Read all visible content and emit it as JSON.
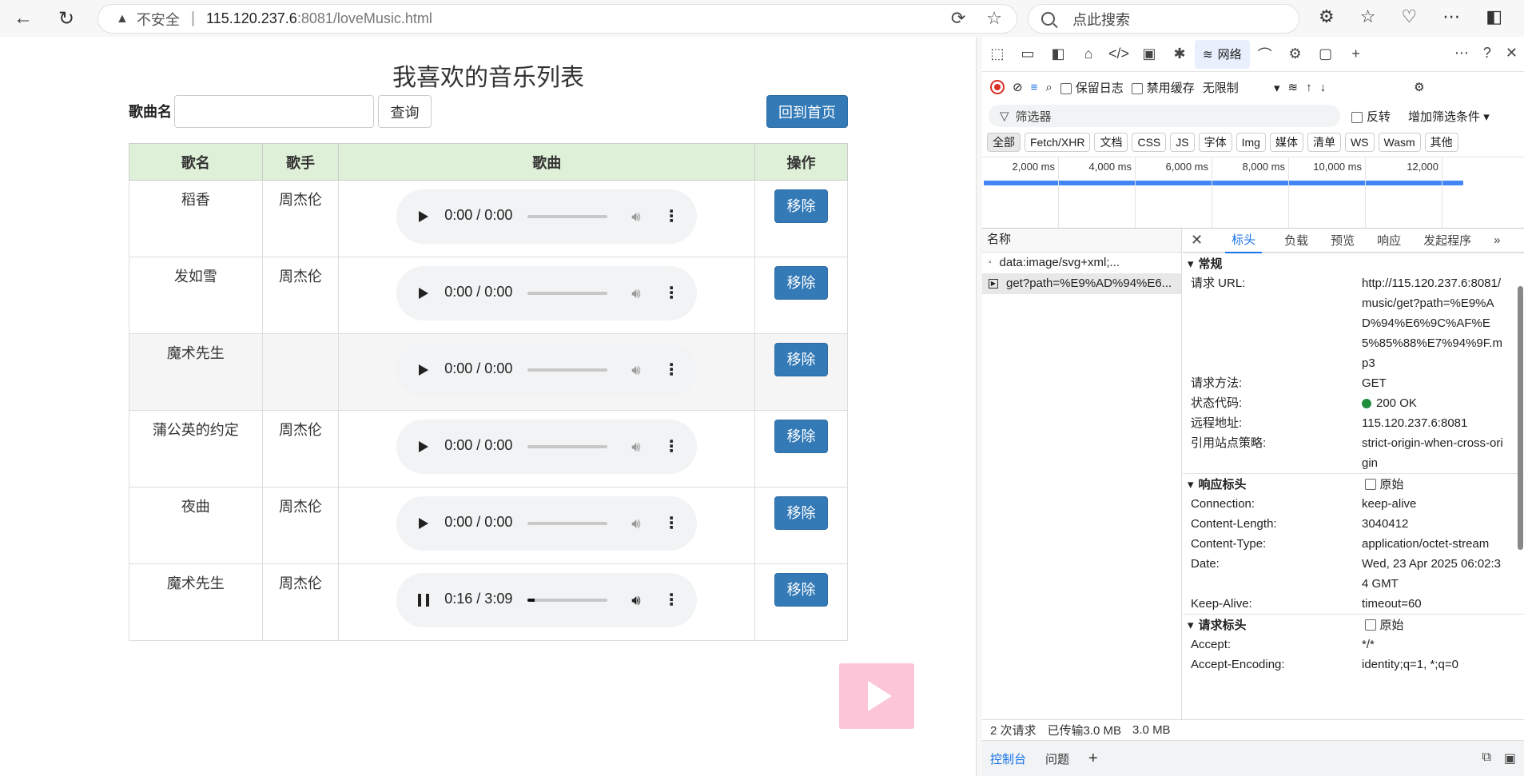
{
  "browser": {
    "insecure_label": "不安全",
    "url_host": "115.120.237.6",
    "url_port": ":8081",
    "url_path": "/loveMusic.html",
    "search_placeholder": "点此搜索"
  },
  "page": {
    "title": "我喜欢的音乐列表",
    "search_label": "歌曲名",
    "search_value": "",
    "query_button": "查询",
    "home_button": "回到首页",
    "columns": [
      "歌名",
      "歌手",
      "歌曲",
      "操作"
    ],
    "remove_label": "移除",
    "rows": [
      {
        "name": "稻香",
        "singer": "周杰伦",
        "time": "0:00 / 0:00",
        "progress": 0
      },
      {
        "name": "发如雪",
        "singer": "周杰伦",
        "time": "0:00 / 0:00",
        "progress": 0
      },
      {
        "name": "魔术先生",
        "singer": "",
        "time": "0:00 / 0:00",
        "progress": 0
      },
      {
        "name": "蒲公英的约定",
        "singer": "周杰伦",
        "time": "0:00 / 0:00",
        "progress": 0
      },
      {
        "name": "夜曲",
        "singer": "周杰伦",
        "time": "0:00 / 0:00",
        "progress": 0
      },
      {
        "name": "魔术先生",
        "singer": "周杰伦",
        "time": "0:16 / 3:09",
        "progress": 0.085,
        "playing": true
      }
    ]
  },
  "devtools": {
    "network_tab": "网络",
    "preserve_log": "保留日志",
    "disable_cache": "禁用缓存",
    "throttle": "无限制",
    "filter_placeholder": "筛选器",
    "invert": "反转",
    "more_filters": "增加筛选条件",
    "types": [
      "全部",
      "Fetch/XHR",
      "文档",
      "CSS",
      "JS",
      "字体",
      "Img",
      "媒体",
      "清单",
      "WS",
      "Wasm",
      "其他"
    ],
    "ticks": [
      "2,000 ms",
      "4,000 ms",
      "6,000 ms",
      "8,000 ms",
      "10,000 ms",
      "12,000"
    ],
    "name_header": "名称",
    "requests": [
      "data:image/svg+xml;...",
      "get?path=%E9%AD%94%E6..."
    ],
    "detail_tabs": [
      "标头",
      "负载",
      "预览",
      "响应",
      "发起程序"
    ],
    "general_title": "常规",
    "general": [
      {
        "k": "请求 URL:",
        "v": "http://115.120.237.6:8081/music/get?path=%E9%AD%94%E6%9C%AF%E5%85%88%E7%94%9F.mp3"
      },
      {
        "k": "请求方法:",
        "v": "GET"
      },
      {
        "k": "状态代码:",
        "v": "200 OK"
      },
      {
        "k": "远程地址:",
        "v": "115.120.237.6:8081"
      },
      {
        "k": "引用站点策略:",
        "v": "strict-origin-when-cross-origin"
      }
    ],
    "response_title": "响应标头",
    "raw_label": "原始",
    "response": [
      {
        "k": "Connection:",
        "v": "keep-alive"
      },
      {
        "k": "Content-Length:",
        "v": "3040412"
      },
      {
        "k": "Content-Type:",
        "v": "application/octet-stream"
      },
      {
        "k": "Date:",
        "v": "Wed, 23 Apr 2025 06:02:34 GMT"
      },
      {
        "k": "Keep-Alive:",
        "v": "timeout=60"
      }
    ],
    "request_title": "请求标头",
    "request": [
      {
        "k": "Accept:",
        "v": "*/*"
      },
      {
        "k": "Accept-Encoding:",
        "v": "identity;q=1, *;q=0"
      }
    ],
    "status_requests": "2 次请求",
    "status_transferred": "已传输3.0 MB",
    "status_resources": "3.0 MB",
    "drawer_console": "控制台",
    "drawer_issues": "问题"
  }
}
